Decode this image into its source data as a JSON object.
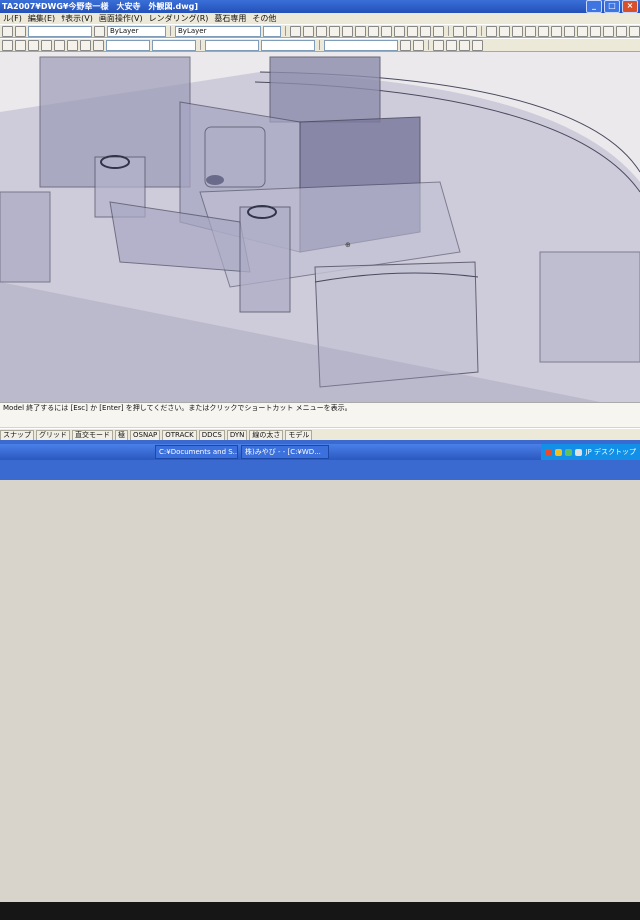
{
  "title_bar": {
    "title": "TA2007¥DWG¥今野幸一様　大安寺　外観図.dwg]"
  },
  "menu": [
    {
      "label": "ル(F)"
    },
    {
      "label": "編集(E)"
    },
    {
      "label": "ｻ表示(V)"
    },
    {
      "label": "画面操作(V)"
    },
    {
      "label": "レンダリング(R)"
    },
    {
      "label": "墓石専用"
    },
    {
      "label": "その他"
    }
  ],
  "toolbar": {
    "layer_combo": "ByLayer",
    "linetype_combo": "ByLayer"
  },
  "command_line": {
    "line1": "Model  終了するには [Esc] か [Enter] を押してください。またはクリックでショートカット メニューを表示。",
    "line2": ""
  },
  "status_bar": {
    "buttons": [
      {
        "label": "スナップ"
      },
      {
        "label": "グリッド"
      },
      {
        "label": "直交モード"
      },
      {
        "label": "極"
      },
      {
        "label": "OSNAP"
      },
      {
        "label": "OTRACK"
      },
      {
        "label": "DDCS"
      },
      {
        "label": "DYN"
      },
      {
        "label": "線の太さ"
      },
      {
        "label": "モデル"
      }
    ]
  },
  "taskbar": {
    "tasks": [
      {
        "label": "C:¥Documents and S..."
      },
      {
        "label": "株)みやび - - [C:¥WD..."
      }
    ],
    "tray_text": "JP デスクトップ"
  },
  "colors": {
    "title_bar": "#2350b8",
    "viewport_bg": "#ebe9ec",
    "model_lines": "#4a4a5e"
  }
}
